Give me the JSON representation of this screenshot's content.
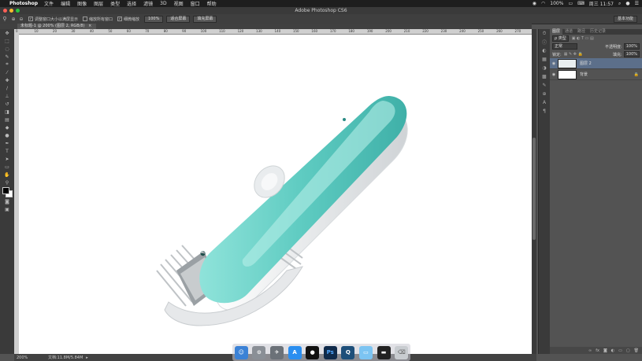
{
  "menubar": {
    "app_name": "Photoshop",
    "items": [
      "文件",
      "编辑",
      "图像",
      "图层",
      "类型",
      "选择",
      "滤镜",
      "3D",
      "视图",
      "窗口",
      "帮助"
    ],
    "battery": "100%",
    "clock": "周三 11:57"
  },
  "window": {
    "title": "Adobe Photoshop CS6"
  },
  "options_bar": {
    "resize_windows_label": "调整窗口大小以满屏显示",
    "zoom_all_label": "缩放所有窗口",
    "scrubby_zoom_label": "细微缩放",
    "btn_100": "100%",
    "btn_fit": "适合屏幕",
    "btn_fill": "填充屏幕",
    "workspace": "基本功能"
  },
  "document": {
    "tab_label": "未标题-1 @ 200% (图层 2, RGB/8)"
  },
  "status": {
    "zoom": "200%",
    "doc_info": "文档:11.8M/5.84M"
  },
  "layers_panel": {
    "tabs": [
      "图层",
      "通道",
      "路径",
      "历史记录"
    ],
    "kind_label": "ρ 类型",
    "blend_mode": "正常",
    "opacity_label": "不透明度:",
    "opacity_value": "100%",
    "lock_label": "锁定:",
    "fill_label": "填充:",
    "fill_value": "100%",
    "layers": [
      {
        "name": "图层 2",
        "selected": true
      },
      {
        "name": "背景",
        "selected": false
      }
    ]
  },
  "colors": {
    "accent_teal": "#6cd2c8",
    "selection": "#5c6f8a"
  },
  "ruler_ticks": [
    "0",
    "10",
    "20",
    "30",
    "40",
    "50",
    "60",
    "70",
    "80",
    "90",
    "100",
    "110",
    "120",
    "130",
    "140",
    "150",
    "160",
    "170",
    "180",
    "190",
    "200",
    "210",
    "220",
    "230",
    "240",
    "250",
    "260",
    "270"
  ]
}
